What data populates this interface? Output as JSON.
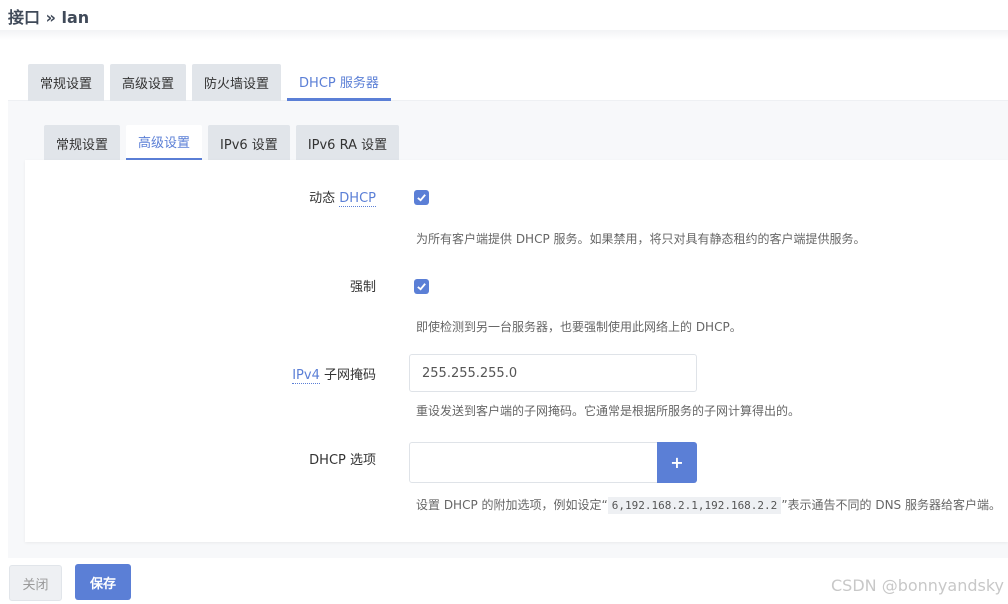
{
  "breadcrumb": "接口 » lan",
  "top_tabs": [
    "常规设置",
    "高级设置",
    "防火墙设置",
    "DHCP 服务器"
  ],
  "sub_tabs": [
    "常规设置",
    "高级设置",
    "IPv6 设置",
    "IPv6 RA 设置"
  ],
  "fields": {
    "dynamic_dhcp": {
      "label_prefix": "动态 ",
      "label_link": "DHCP",
      "checked": true,
      "description": "为所有客户端提供 DHCP 服务。如果禁用，将只对具有静态租约的客户端提供服务。"
    },
    "force": {
      "label": "强制",
      "checked": true,
      "description": "即使检测到另一台服务器，也要强制使用此网络上的 DHCP。"
    },
    "netmask": {
      "label_link": "IPv4",
      "label_suffix": " 子网掩码",
      "value": "255.255.255.0",
      "description": "重设发送到客户端的子网掩码。它通常是根据所服务的子网计算得出的。"
    },
    "dhcp_options": {
      "label": "DHCP 选项",
      "value": "",
      "add_label": "+",
      "description_prefix": "设置 DHCP 的附加选项，例如设定“",
      "description_code": "6,192.168.2.1,192.168.2.2",
      "description_suffix": "”表示通告不同的 DNS 服务器给客户端。"
    }
  },
  "buttons": {
    "close": "关闭",
    "save": "保存"
  },
  "watermark": "CSDN @bonnyandsky",
  "colors": {
    "accent": "#5b7fd6",
    "tab_inactive": "#e1e5ea"
  }
}
